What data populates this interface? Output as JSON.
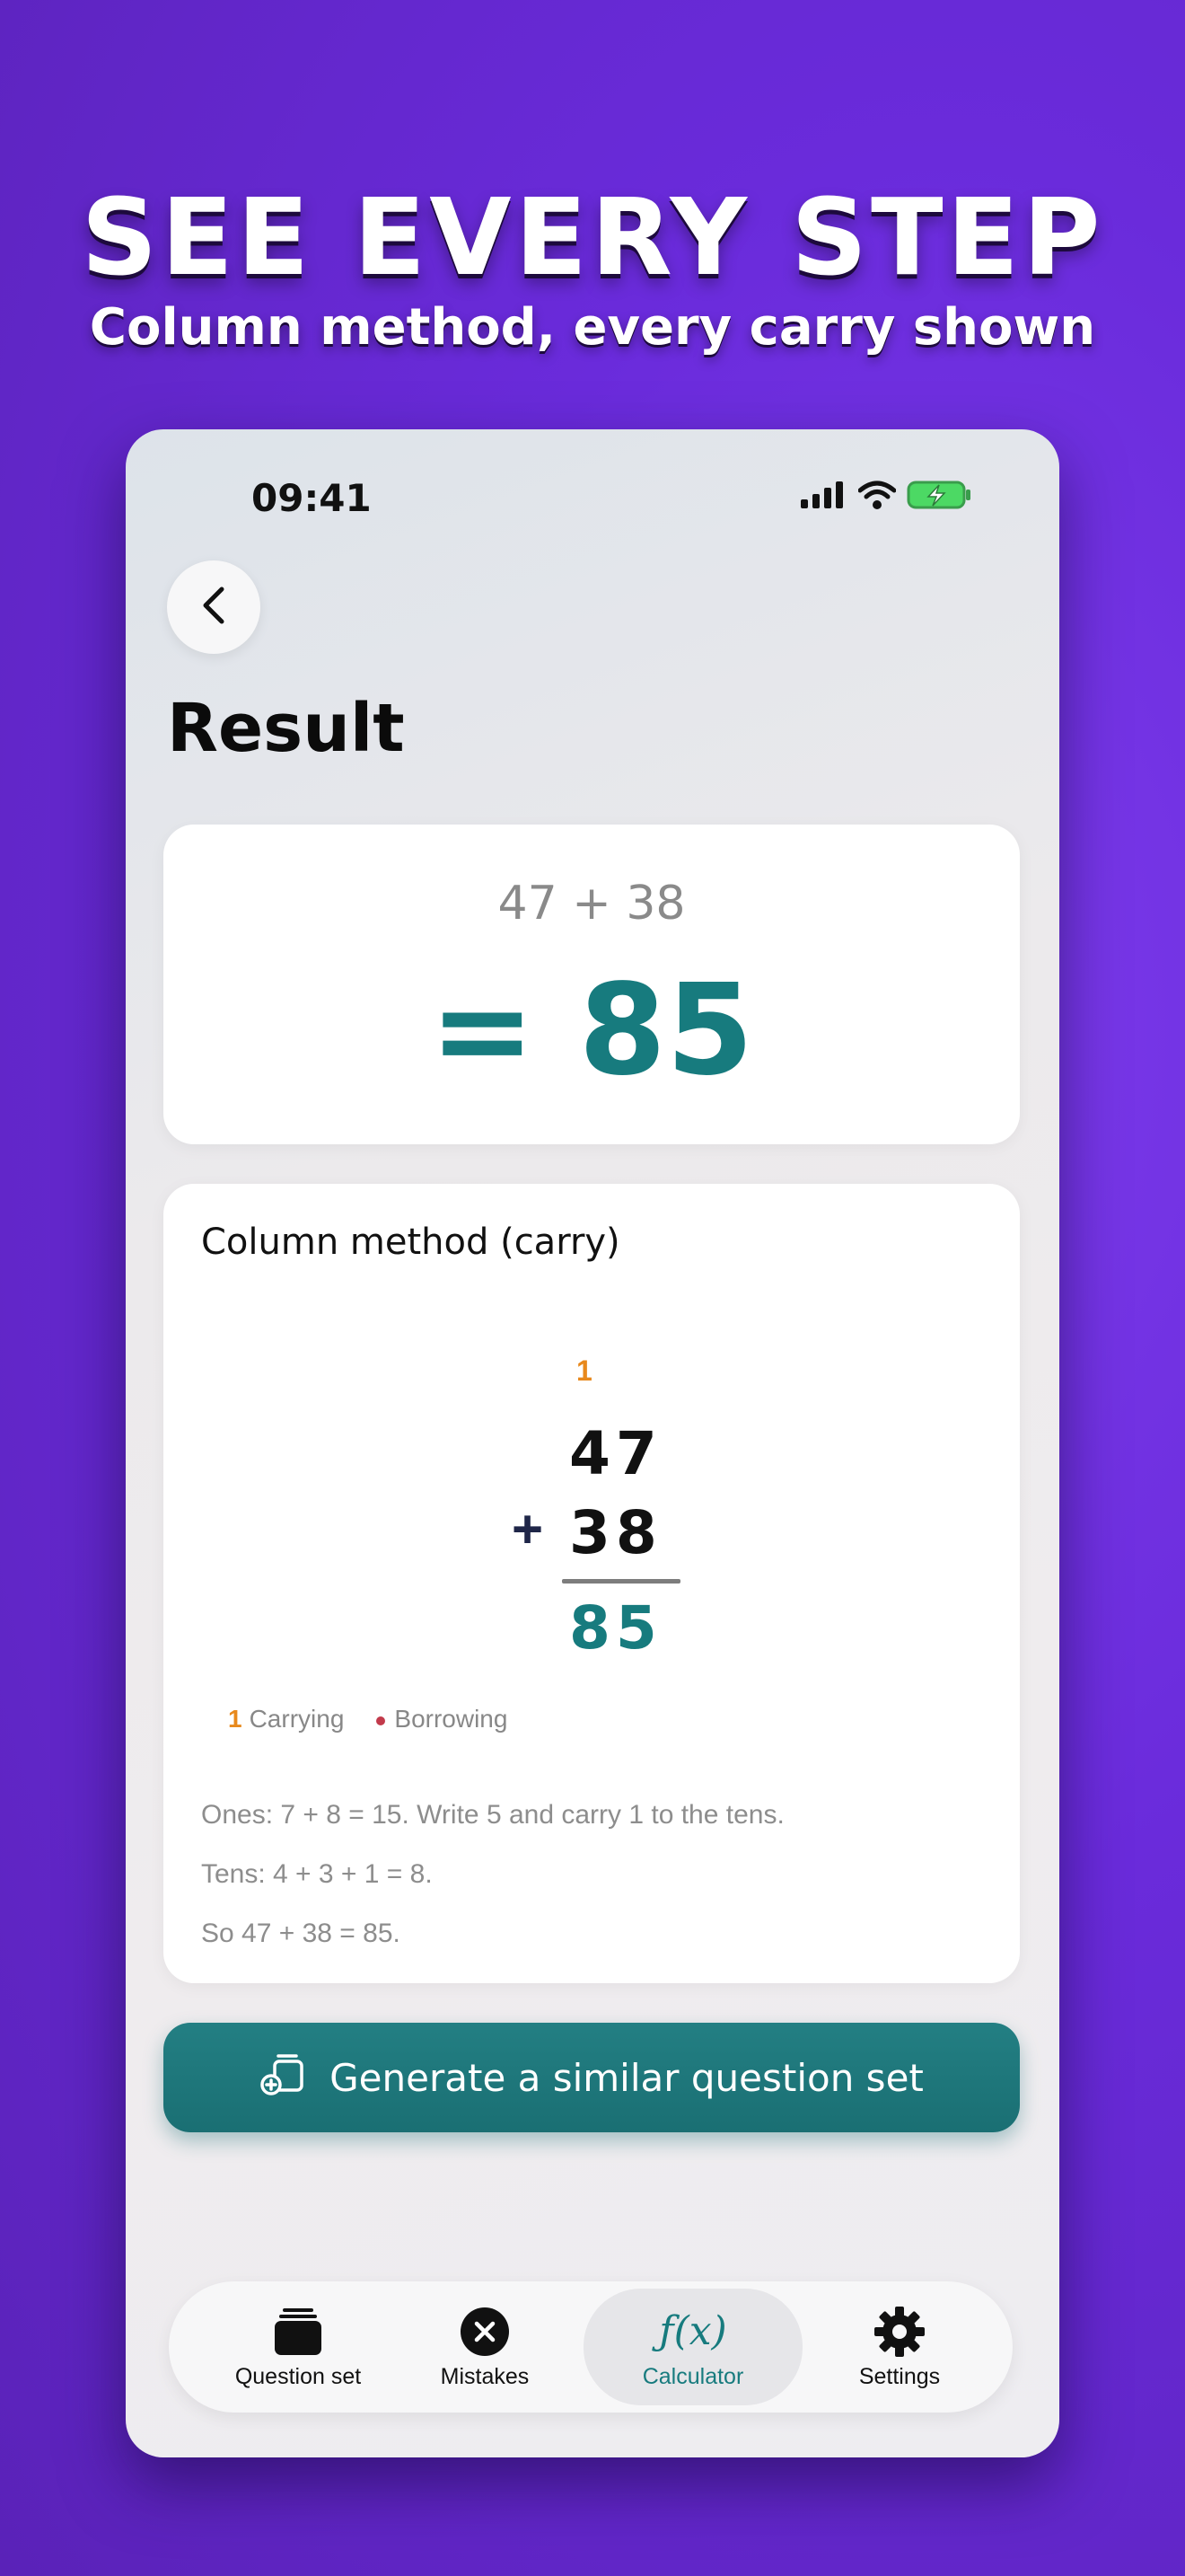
{
  "promo": {
    "headline": "SEE EVERY STEP",
    "subline": "Column method, every carry shown"
  },
  "status_bar": {
    "time": "09:41"
  },
  "page": {
    "title": "Result"
  },
  "result_card": {
    "expression": "47 + 38",
    "answer": "= 85"
  },
  "method_card": {
    "title": "Column method (carry)",
    "carry": "1",
    "first_number": "47",
    "operator": "+",
    "second_number": "38",
    "sum": "85",
    "legend": {
      "carry_mark": "1",
      "carry_label": "Carrying",
      "borrow_label": "Borrowing"
    },
    "steps": [
      "Ones: 7 + 8 = 15. Write 5 and carry 1 to the tens.",
      "Tens: 4 + 3 + 1 = 8.",
      "So 47 + 38 = 85."
    ]
  },
  "actions": {
    "generate_label": "Generate a similar question set"
  },
  "tab_bar": {
    "tabs": [
      {
        "label": "Question set",
        "icon": "stack-icon"
      },
      {
        "label": "Mistakes",
        "icon": "x-circle-icon"
      },
      {
        "label": "Calculator",
        "icon": "function-icon",
        "glyph": "ƒ(x)",
        "active": true
      },
      {
        "label": "Settings",
        "icon": "gear-icon"
      }
    ]
  },
  "colors": {
    "background": "#6a2bdb",
    "accent": "#177b7e",
    "carry": "#e8891c",
    "borrow": "#c23a4b"
  }
}
